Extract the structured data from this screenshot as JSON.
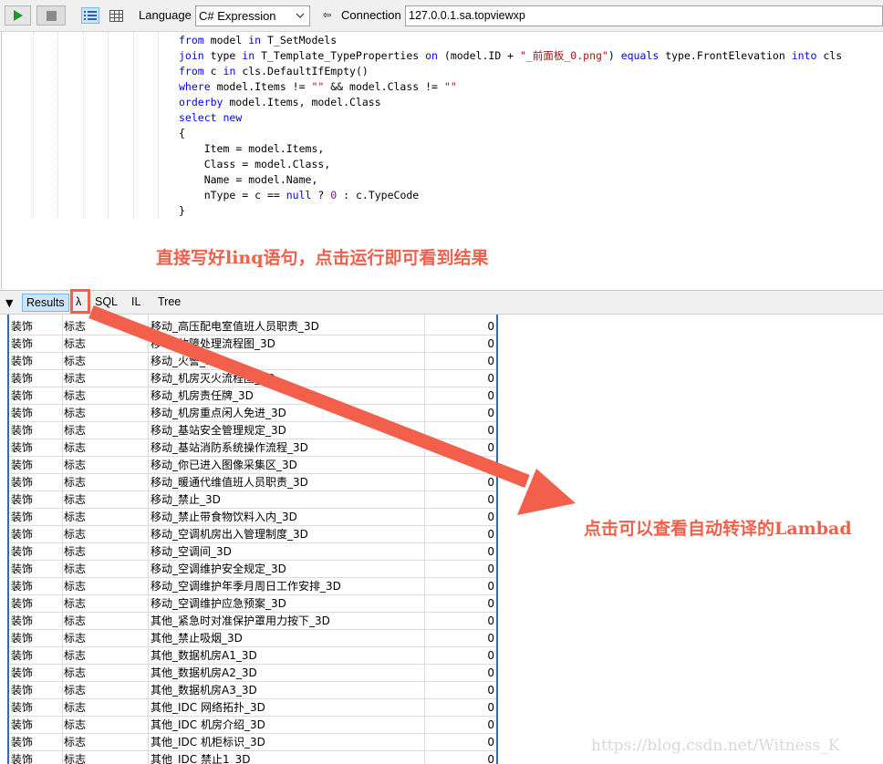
{
  "toolbar": {
    "language_label": "Language",
    "language_value": "C# Expression",
    "connection_label": "Connection",
    "connection_value": "127.0.0.1.sa.topviewxp"
  },
  "editor": {
    "lines": [
      "from model in T_SetModels",
      "join type in T_Template_TypeProperties on (model.ID + \"_前面板_0.png\") equals type.FrontElevation into cls",
      "from c in cls.DefaultIfEmpty()",
      "where model.Items != \"\" && model.Class != \"\"",
      "orderby model.Items, model.Class",
      "select new",
      "{",
      "    Item = model.Items,",
      "    Class = model.Class,",
      "    Name = model.Name,",
      "    nType = c == null ? 0 : c.TypeCode",
      "}"
    ]
  },
  "annotations": {
    "editor_note": "直接写好linq语句，点击运行即可看到结果",
    "lambda_note": "点击可以查看自动转译的Lambad"
  },
  "result_tabs": [
    "Results",
    "λ",
    "SQL",
    "IL",
    "Tree"
  ],
  "results": {
    "rows": [
      [
        "装饰",
        "标志",
        "移动_高压配电室值班人员职责_3D",
        "0"
      ],
      [
        "装饰",
        "标志",
        "移动_故障处理流程图_3D",
        "0"
      ],
      [
        "装饰",
        "标志",
        "移动_火警_3D",
        "0"
      ],
      [
        "装饰",
        "标志",
        "移动_机房灭火流程图_3D",
        "0"
      ],
      [
        "装饰",
        "标志",
        "移动_机房责任牌_3D",
        "0"
      ],
      [
        "装饰",
        "标志",
        "移动_机房重点闲人免进_3D",
        "0"
      ],
      [
        "装饰",
        "标志",
        "移动_基站安全管理规定_3D",
        "0"
      ],
      [
        "装饰",
        "标志",
        "移动_基站消防系统操作流程_3D",
        "0"
      ],
      [
        "装饰",
        "标志",
        "移动_你已进入图像采集区_3D",
        "0"
      ],
      [
        "装饰",
        "标志",
        "移动_暖通代维值班人员职责_3D",
        "0"
      ],
      [
        "装饰",
        "标志",
        "移动_禁止_3D",
        "0"
      ],
      [
        "装饰",
        "标志",
        "移动_禁止带食物饮料入内_3D",
        "0"
      ],
      [
        "装饰",
        "标志",
        "移动_空调机房出入管理制度_3D",
        "0"
      ],
      [
        "装饰",
        "标志",
        "移动_空调间_3D",
        "0"
      ],
      [
        "装饰",
        "标志",
        "移动_空调维护安全规定_3D",
        "0"
      ],
      [
        "装饰",
        "标志",
        "移动_空调维护年季月周日工作安排_3D",
        "0"
      ],
      [
        "装饰",
        "标志",
        "移动_空调维护应急预案_3D",
        "0"
      ],
      [
        "装饰",
        "标志",
        "其他_紧急时对准保护罩用力按下_3D",
        "0"
      ],
      [
        "装饰",
        "标志",
        "其他_禁止吸烟_3D",
        "0"
      ],
      [
        "装饰",
        "标志",
        "其他_数据机房A1_3D",
        "0"
      ],
      [
        "装饰",
        "标志",
        "其他_数据机房A2_3D",
        "0"
      ],
      [
        "装饰",
        "标志",
        "其他_数据机房A3_3D",
        "0"
      ],
      [
        "装饰",
        "标志",
        "其他_IDC 网络拓扑_3D",
        "0"
      ],
      [
        "装饰",
        "标志",
        "其他_IDC 机房介绍_3D",
        "0"
      ],
      [
        "装饰",
        "标志",
        "其他_IDC 机柜标识_3D",
        "0"
      ],
      [
        "装饰",
        "标志",
        "其他_IDC 禁止1_3D",
        "0"
      ]
    ]
  },
  "watermark": "https://blog.csdn.net/Witness_K",
  "colors": {
    "annotation": "#f2604c",
    "keyword": "#0000ff",
    "grid_border": "#2d6db5"
  }
}
